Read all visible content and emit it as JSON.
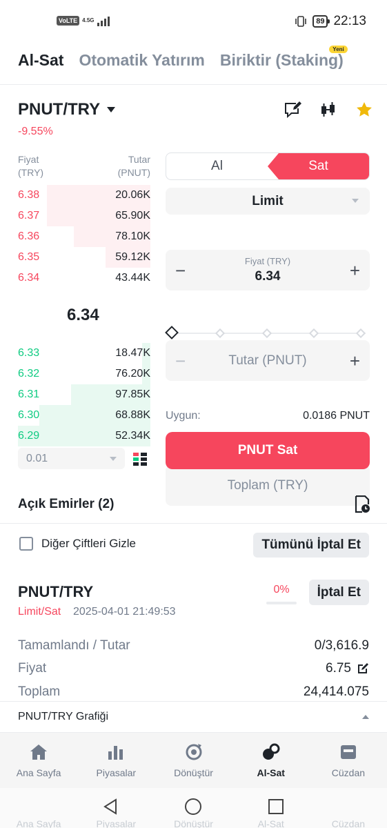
{
  "status_bar": {
    "volte": "VoLTE",
    "network": "4.5G",
    "battery": "89",
    "time": "22:13"
  },
  "top_tabs": [
    {
      "label": "Al-Sat",
      "active": true
    },
    {
      "label": "Otomatik Yatırım",
      "active": false
    },
    {
      "label": "Biriktir (Staking)",
      "active": false,
      "badge": "Yeni"
    }
  ],
  "pair": {
    "symbol": "PNUT/TRY",
    "change": "-9.55%"
  },
  "order_book": {
    "price_header": "Fiyat\n(TRY)",
    "price_header_1": "Fiyat",
    "price_header_2": "(TRY)",
    "amount_header_1": "Tutar",
    "amount_header_2": "(PNUT)",
    "asks": [
      {
        "price": "6.38",
        "amount": "20.06K",
        "depth": 0.78
      },
      {
        "price": "6.37",
        "amount": "65.90K",
        "depth": 0.78
      },
      {
        "price": "6.36",
        "amount": "78.10K",
        "depth": 0.58
      },
      {
        "price": "6.35",
        "amount": "59.12K",
        "depth": 0.34
      },
      {
        "price": "6.34",
        "amount": "43.44K",
        "depth": 0.0
      }
    ],
    "mid_price": "6.34",
    "bids": [
      {
        "price": "6.33",
        "amount": "18.47K",
        "depth": 0.06
      },
      {
        "price": "6.32",
        "amount": "76.20K",
        "depth": 0.06
      },
      {
        "price": "6.31",
        "amount": "97.85K",
        "depth": 0.6
      },
      {
        "price": "6.30",
        "amount": "68.88K",
        "depth": 0.84
      },
      {
        "price": "6.29",
        "amount": "52.34K",
        "depth": 1.0
      }
    ],
    "precision": "0.01"
  },
  "order_form": {
    "buy_label": "Al",
    "sell_label": "Sat",
    "order_type": "Limit",
    "price_label": "Fiyat (TRY)",
    "price_value": "6.34",
    "amount_placeholder": "Tutar (PNUT)",
    "total_placeholder": "Toplam (TRY)",
    "available_label": "Uygun:",
    "available_value": "0.0186 PNUT",
    "submit_label": "PNUT Sat",
    "minus": "−",
    "plus": "+"
  },
  "open_orders": {
    "title": "Açık Emirler (2)",
    "hide_pairs_label": "Diğer Çiftleri Gizle",
    "cancel_all_label": "Tümünü İptal Et",
    "order": {
      "pair": "PNUT/TRY",
      "fill_percent": "0%",
      "cancel_label": "İptal Et",
      "type": "Limit/Sat",
      "time": "2025-04-01 21:49:53",
      "filled_label": "Tamamlandı / Tutar",
      "filled_value": "0/3,616.9",
      "price_label": "Fiyat",
      "price_value": "6.75",
      "total_label": "Toplam",
      "total_value": "24,414.075"
    }
  },
  "chart_strip": {
    "label": "PNUT/TRY Grafiği"
  },
  "bottom_nav": [
    {
      "label": "Ana Sayfa",
      "icon": "home-icon",
      "active": false
    },
    {
      "label": "Piyasalar",
      "icon": "markets-icon",
      "active": false
    },
    {
      "label": "Dönüştür",
      "icon": "convert-icon",
      "active": false
    },
    {
      "label": "Al-Sat",
      "icon": "trade-icon",
      "active": true
    },
    {
      "label": "Cüzdan",
      "icon": "wallet-icon",
      "active": false
    }
  ],
  "colors": {
    "sell": "#f6465d",
    "buy": "#0ecb81",
    "star": "#f0b90b",
    "badge": "#fcd535"
  }
}
